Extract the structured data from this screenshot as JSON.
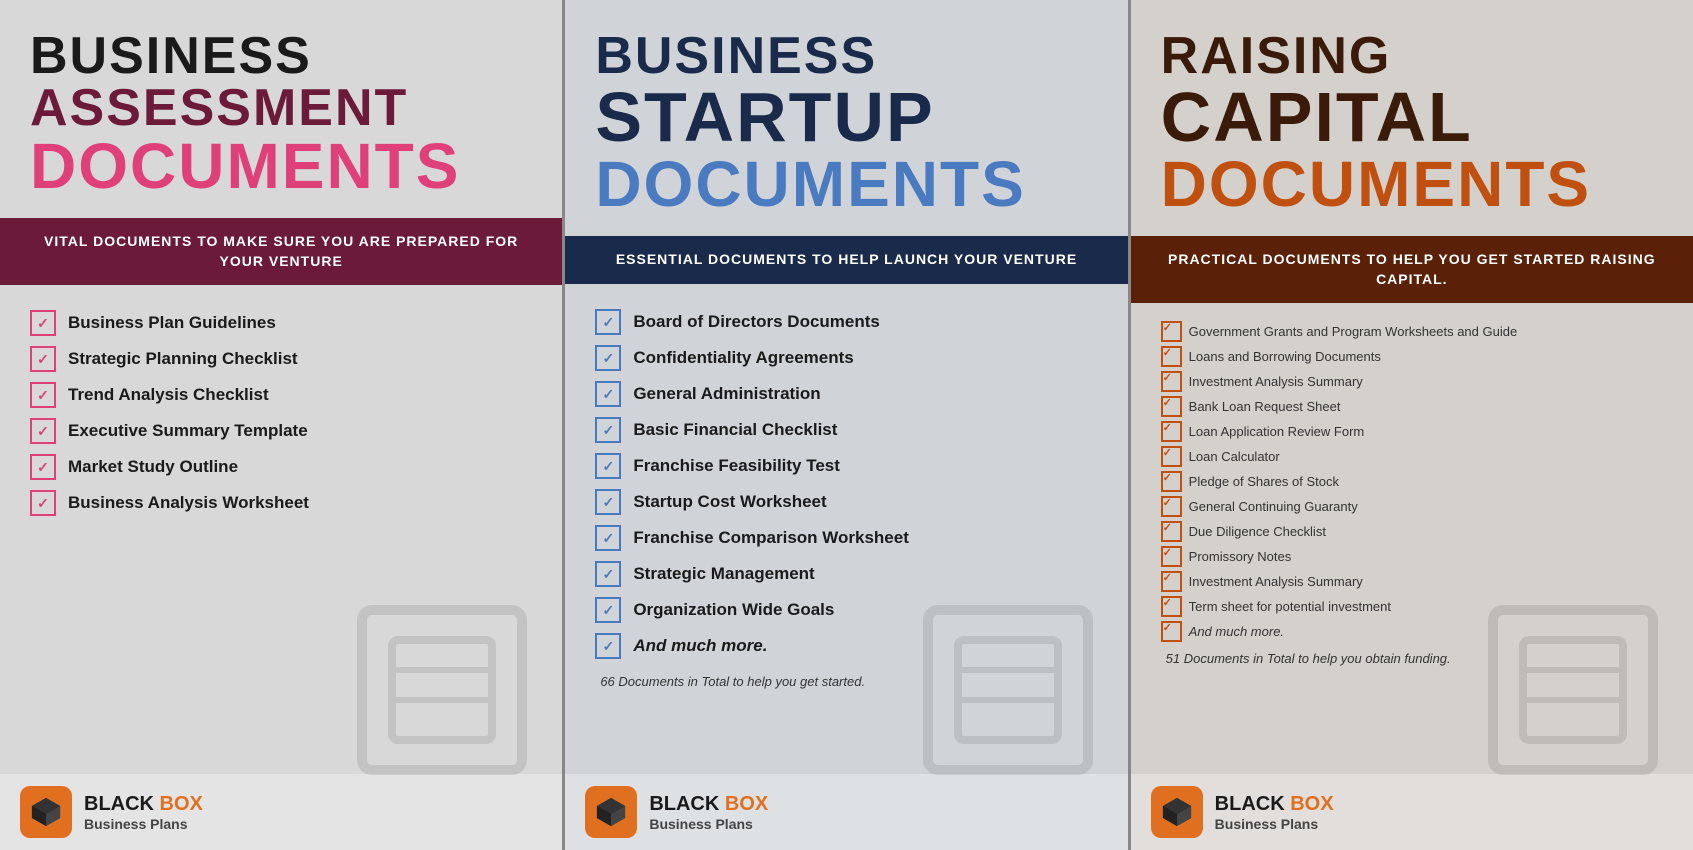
{
  "panels": [
    {
      "id": "panel-1",
      "title_line1": "BUSINESS",
      "title_line2": "ASSESSMENT",
      "title_line3": "DOCUMENTS",
      "banner": "VITAL DOCUMENTS TO MAKE SURE YOU ARE PREPARED FOR YOUR VENTURE",
      "items": [
        "Business Plan Guidelines",
        "Strategic Planning Checklist",
        "Trend Analysis Checklist",
        "Executive Summary Template",
        "Market Study Outline",
        "Business Analysis Worksheet"
      ],
      "footnote": null,
      "logo_black": "Black Box",
      "logo_sub": "Business Plans"
    },
    {
      "id": "panel-2",
      "title_line1": "BUSINESS",
      "title_line2": "STARTUP",
      "title_line3": "DOCUMENTS",
      "banner": "ESSENTIAL DOCUMENTS TO HELP LAUNCH YOUR VENTURE",
      "items": [
        "Board of Directors Documents",
        "Confidentiality Agreements",
        "General Administration",
        "Basic Financial Checklist",
        "Franchise Feasibility Test",
        "Startup Cost Worksheet",
        "Franchise Comparison Worksheet",
        "Strategic Management",
        "Organization Wide Goals",
        "And much more."
      ],
      "footnote": "66 Documents in Total to help you get started.",
      "logo_black": "Black Box",
      "logo_sub": "Business Plans"
    },
    {
      "id": "panel-3",
      "title_line1": "RAISING",
      "title_line2": "CAPITAL",
      "title_line3": "DOCUMENTS",
      "banner": "PRACTICAL DOCUMENTS TO HELP YOU GET STARTED RAISING CAPITAL.",
      "items": [
        "Government Grants and Program Worksheets and Guide",
        "Loans and Borrowing Documents",
        "Investment Analysis Summary",
        "Bank Loan Request Sheet",
        "Loan Application Review Form",
        "Loan Calculator",
        "Pledge of Shares of Stock",
        "General Continuing Guaranty",
        "Due Diligence Checklist",
        "Promissory Notes",
        "Investment Analysis Summary",
        "Term sheet for potential investment",
        "And much more."
      ],
      "footnote": "51 Documents in Total to help you obtain funding.",
      "logo_black": "Black Box",
      "logo_sub": "Business Plans"
    }
  ]
}
